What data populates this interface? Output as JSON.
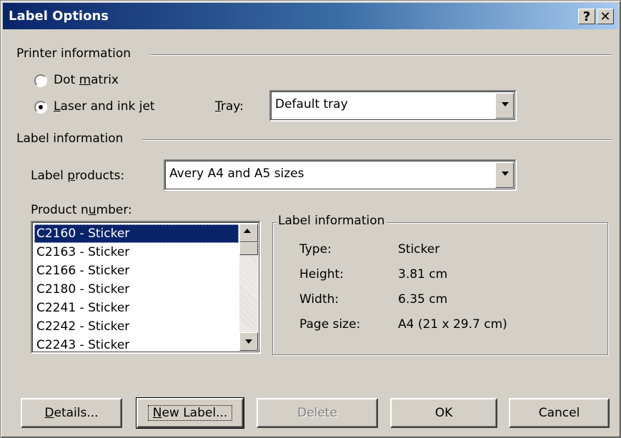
{
  "window": {
    "title": "Label Options",
    "help_btn": "?",
    "close_btn": "✕"
  },
  "printer": {
    "group_title": "Printer information",
    "dot_matrix": {
      "pre": "Dot ",
      "key": "m",
      "post": "atrix",
      "selected": false
    },
    "laser": {
      "pre": "",
      "key": "L",
      "post": "aser and ink jet",
      "selected": true
    },
    "tray_label": {
      "pre": "",
      "key": "T",
      "post": "ray:"
    },
    "tray_value": "Default tray"
  },
  "label_info": {
    "group_title": "Label information",
    "products_label": {
      "pre": "Label ",
      "key": "p",
      "post": "roducts:"
    },
    "products_value": "Avery A4 and A5 sizes",
    "product_number_label": {
      "pre": "Product n",
      "key": "u",
      "post": "mber:"
    },
    "product_numbers": [
      "C2160 - Sticker",
      "C2163 - Sticker",
      "C2166 - Sticker",
      "C2180 - Sticker",
      "C2241 - Sticker",
      "C2242 - Sticker",
      "C2243 - Sticker"
    ],
    "selected_index": 0,
    "details_title": "Label information",
    "details": [
      {
        "key": "Type:",
        "value": "Sticker"
      },
      {
        "key": "Height:",
        "value": "3.81 cm"
      },
      {
        "key": "Width:",
        "value": "6.35 cm"
      },
      {
        "key": "Page size:",
        "value": "A4 (21 x 29.7 cm)"
      }
    ]
  },
  "buttons": {
    "details": {
      "pre": "",
      "key": "D",
      "post": "etails..."
    },
    "new_label": {
      "pre": "",
      "key": "N",
      "post": "ew Label..."
    },
    "delete": "Delete",
    "ok": "OK",
    "cancel": "Cancel"
  },
  "colors": {
    "title_gradient_start": "#0a246a",
    "title_gradient_end": "#a6caf0",
    "face": "#d4d0c8",
    "selection": "#0a246a"
  }
}
